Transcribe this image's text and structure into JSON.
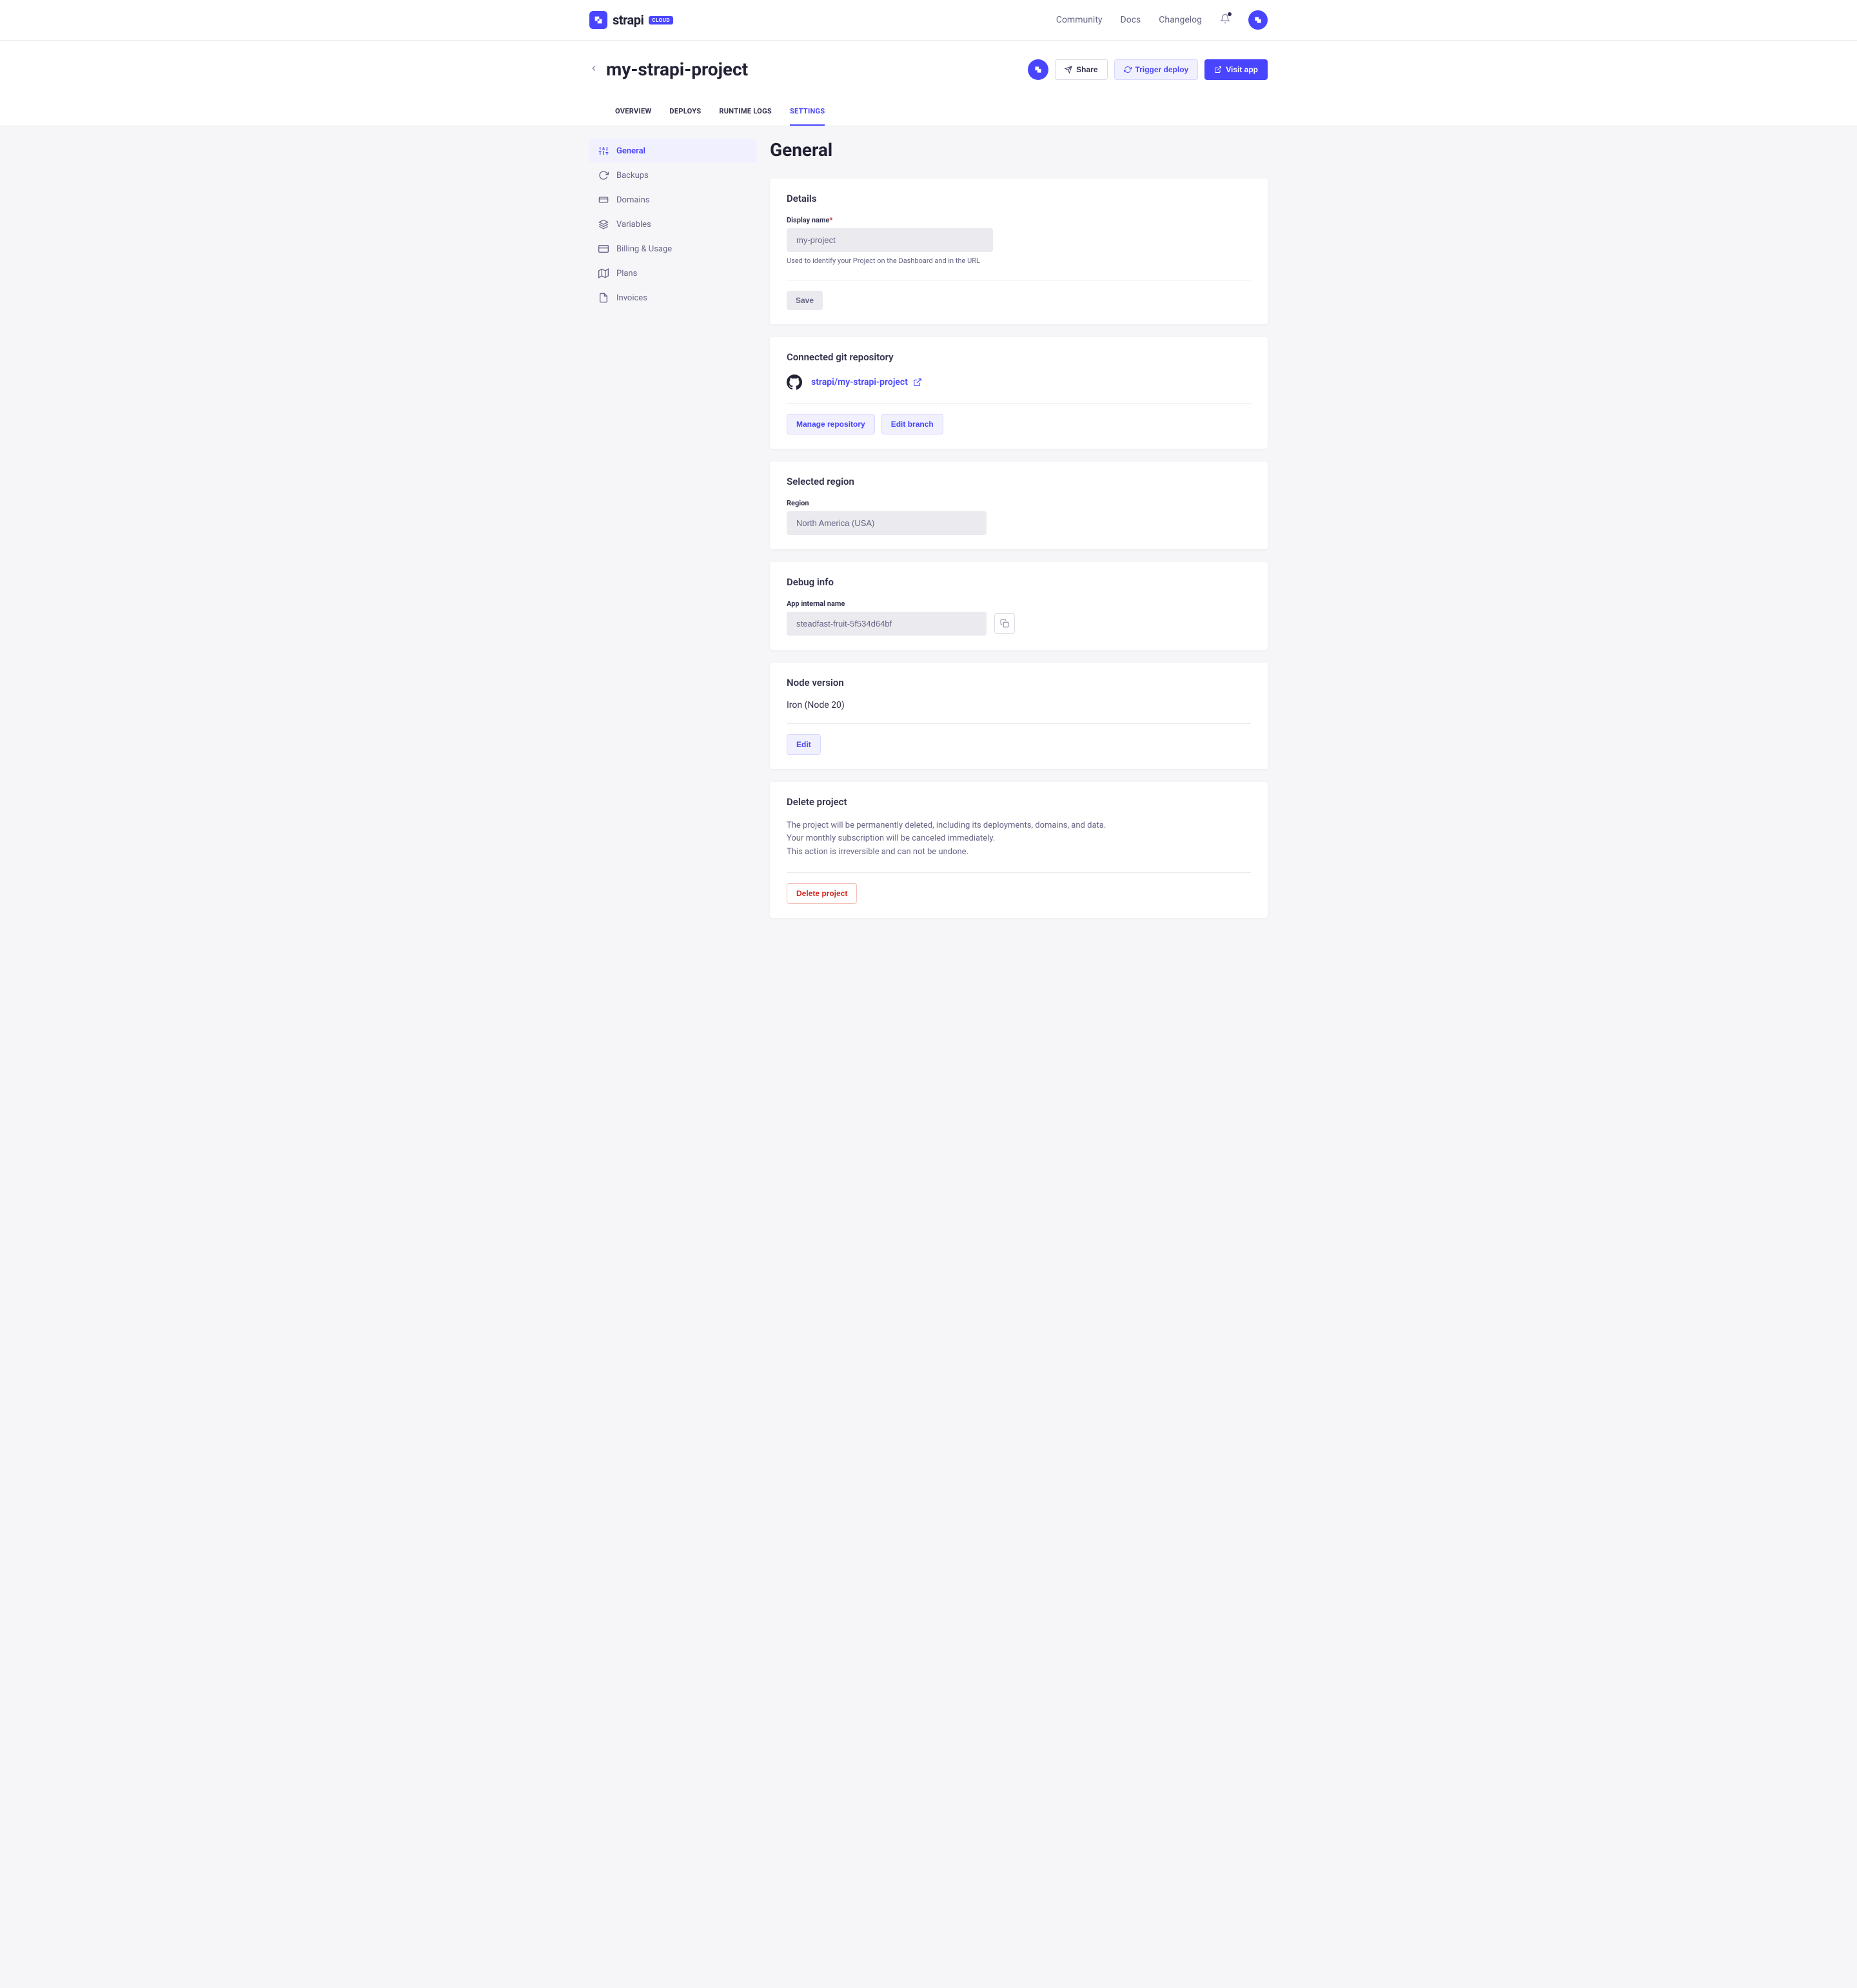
{
  "topnav": {
    "logo_text": "strapi",
    "logo_badge": "CLOUD",
    "links": [
      "Community",
      "Docs",
      "Changelog"
    ]
  },
  "header": {
    "title": "my-strapi-project",
    "share": "Share",
    "trigger": "Trigger deploy",
    "visit": "Visit app"
  },
  "tabs": [
    "OVERVIEW",
    "DEPLOYS",
    "RUNTIME LOGS",
    "SETTINGS"
  ],
  "sidebar": {
    "items": [
      {
        "label": "General"
      },
      {
        "label": "Backups"
      },
      {
        "label": "Domains"
      },
      {
        "label": "Variables"
      },
      {
        "label": "Billing & Usage"
      },
      {
        "label": "Plans"
      },
      {
        "label": "Invoices"
      }
    ]
  },
  "page_title": "General",
  "details": {
    "title": "Details",
    "display_label": "Display name",
    "display_value": "my-project",
    "help": "Used to identify your Project on the Dashboard and in the URL",
    "save": "Save"
  },
  "git": {
    "title": "Connected git repository",
    "repo": "strapi/my-strapi-project",
    "manage": "Manage repository",
    "edit_branch": "Edit branch"
  },
  "region": {
    "title": "Selected region",
    "label": "Region",
    "value": "North America (USA)"
  },
  "debug": {
    "title": "Debug info",
    "label": "App internal name",
    "value": "steadfast-fruit-5f534d64bf"
  },
  "node": {
    "title": "Node version",
    "value": "Iron (Node 20)",
    "edit": "Edit"
  },
  "delete": {
    "title": "Delete project",
    "line1": "The project will be permanently deleted, including its deployments, domains, and data.",
    "line2": "Your monthly subscription will be canceled immediately.",
    "line3": "This action is irreversible and can not be undone.",
    "button": "Delete project"
  }
}
